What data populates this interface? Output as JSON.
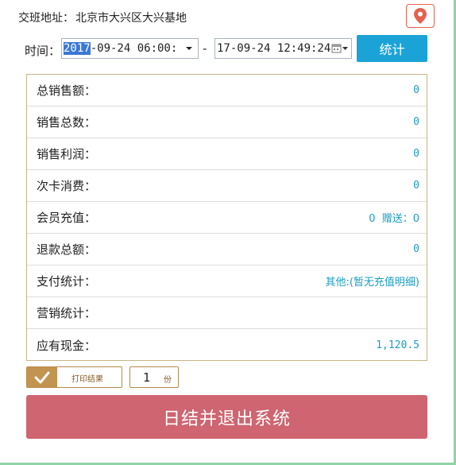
{
  "header": {
    "address_label": "交班地址：",
    "address_value": "北京市大兴区大兴基地",
    "location_icon": "map-pin-icon",
    "accent_color": "#e5604d"
  },
  "time_range": {
    "label": "时间：",
    "start_highlight": "2017",
    "start_rest": "-09-24 06:00:",
    "separator": "-",
    "end_value": "17-09-24 12:49:24",
    "stat_button": "统计"
  },
  "summary": {
    "rows": [
      {
        "label": "总销售额：",
        "value": "0"
      },
      {
        "label": "销售总数：",
        "value": "0"
      },
      {
        "label": "销售利润：",
        "value": "0"
      },
      {
        "label": "次卡消费：",
        "value": "0"
      },
      {
        "label": "会员充值：",
        "value": "0  赠送：0"
      },
      {
        "label": "退款总额：",
        "value": "0"
      },
      {
        "label": "支付统计：",
        "value": "其他:(暂无充值明细)"
      },
      {
        "label": "营销统计：",
        "value": ""
      },
      {
        "label": "应有现金：",
        "value": "1,120.5"
      }
    ]
  },
  "print": {
    "toggle_label": "打印结果",
    "copies_value": "1",
    "copies_unit": "份"
  },
  "footer": {
    "exit_button": "日结并退出系统"
  }
}
